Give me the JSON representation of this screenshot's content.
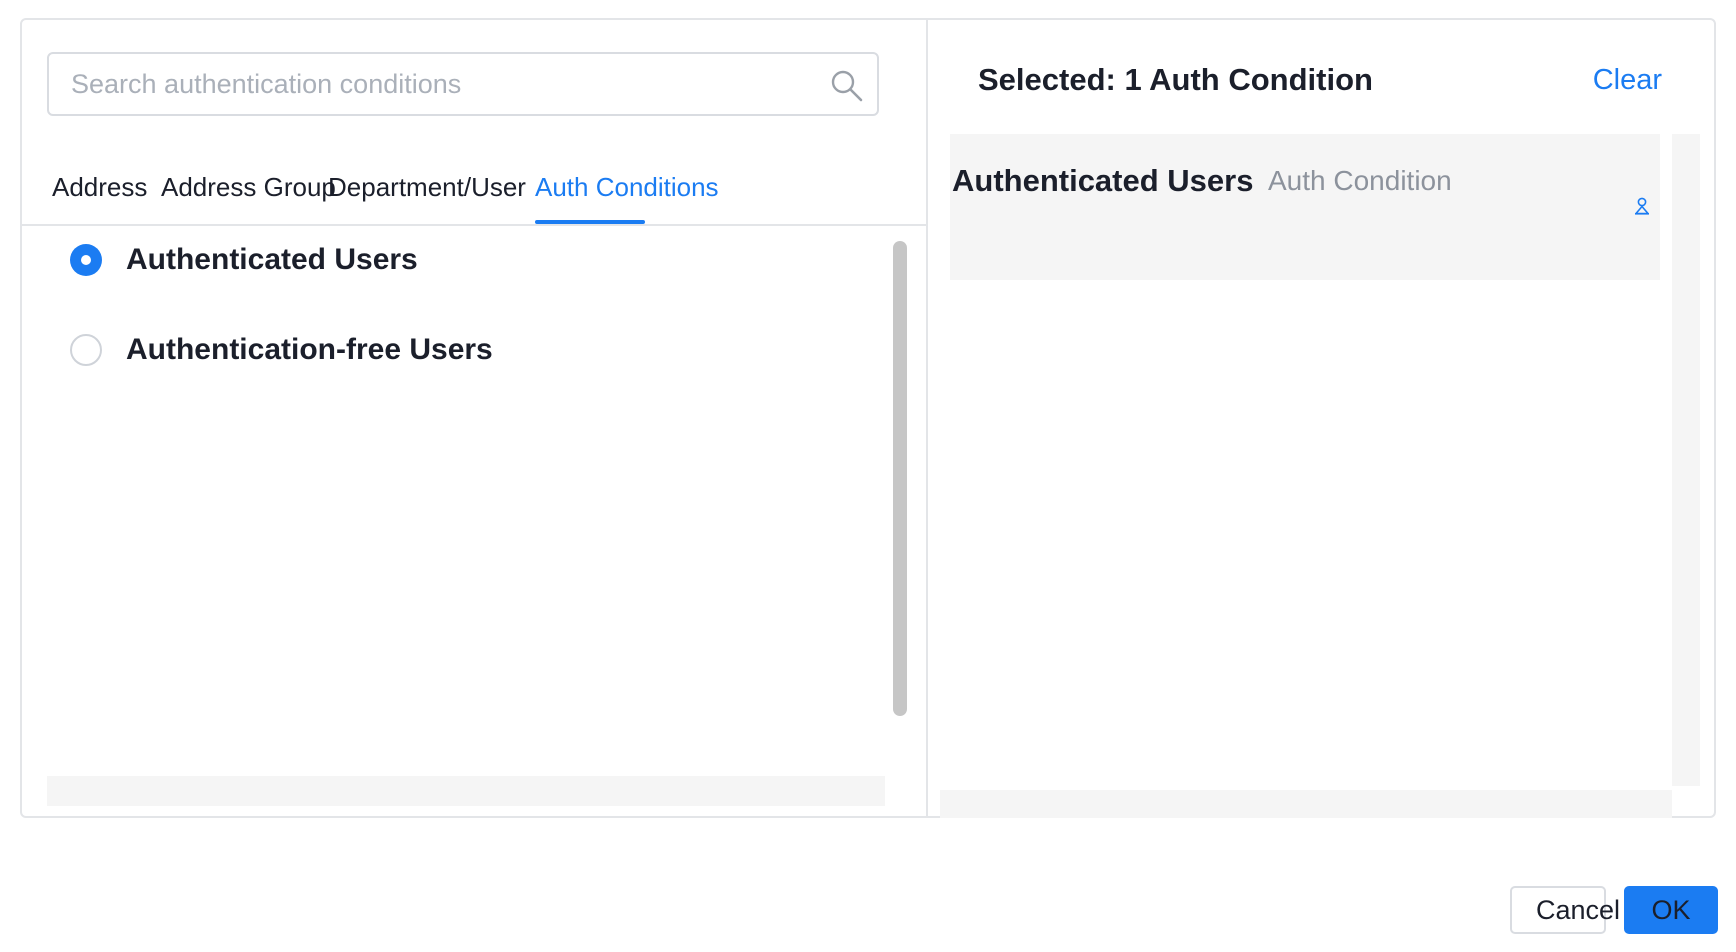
{
  "search": {
    "placeholder": "Search authentication conditions",
    "value": "",
    "icon": "search-icon"
  },
  "tabs": [
    {
      "label": "Address",
      "active": false
    },
    {
      "label": "Address Group",
      "active": false
    },
    {
      "label": "Department/User",
      "active": false
    },
    {
      "label": "Auth Conditions",
      "active": true
    }
  ],
  "options": [
    {
      "label": "Authenticated Users",
      "checked": true
    },
    {
      "label": "Authentication-free Users",
      "checked": false
    }
  ],
  "selected_panel": {
    "title": "Selected: 1 Auth Condition",
    "clear_label": "Clear",
    "items": [
      {
        "name": "Authenticated Users",
        "type": "Auth Condition",
        "icon": "user-icon"
      }
    ]
  },
  "footer": {
    "cancel_label": "Cancel",
    "ok_label": "OK"
  },
  "colors": {
    "accent": "#1b7cf2",
    "border": "#e3e5e8",
    "placeholder": "#aab0b9",
    "muted_text": "#8c929c"
  }
}
